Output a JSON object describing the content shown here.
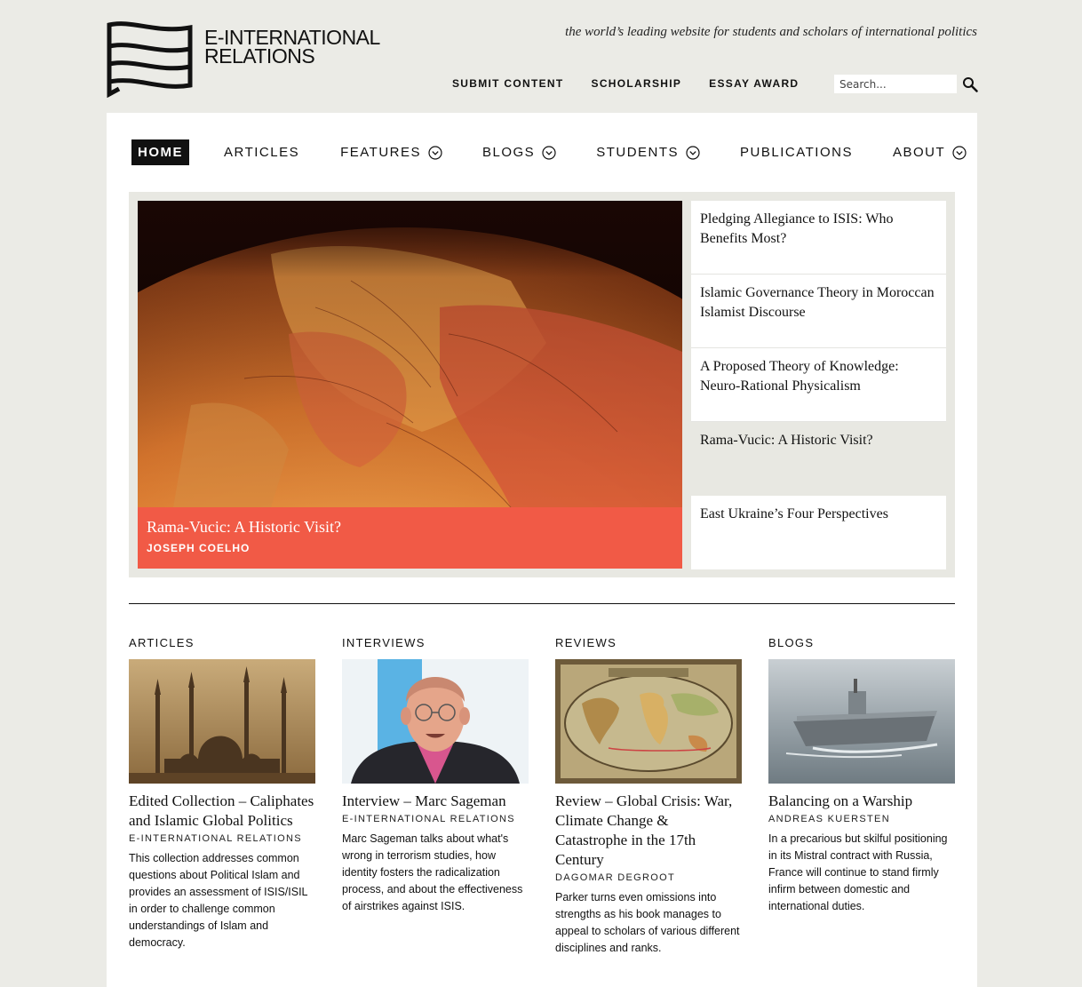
{
  "header": {
    "logo_line1": "E-INTERNATIONAL",
    "logo_line2": "RELATIONS",
    "tagline": "the world’s leading website for students and scholars of international politics",
    "top_links": [
      "SUBMIT CONTENT",
      "SCHOLARSHIP",
      "ESSAY AWARD"
    ],
    "search_placeholder": "Search..."
  },
  "main_nav": {
    "items": [
      {
        "label": "HOME",
        "active": true,
        "dropdown": false
      },
      {
        "label": "ARTICLES",
        "active": false,
        "dropdown": false
      },
      {
        "label": "FEATURES",
        "active": false,
        "dropdown": true
      },
      {
        "label": "BLOGS",
        "active": false,
        "dropdown": true
      },
      {
        "label": "STUDENTS",
        "active": false,
        "dropdown": true
      },
      {
        "label": "PUBLICATIONS",
        "active": false,
        "dropdown": false
      },
      {
        "label": "ABOUT",
        "active": false,
        "dropdown": true
      }
    ]
  },
  "featured": {
    "hero_title": "Rama-Vucic: A Historic Visit?",
    "hero_author": "JOSEPH COELHO",
    "hero_image": "globe-europe-map",
    "side_items": [
      "Pledging Allegiance to ISIS:  Who Benefits Most?",
      "Islamic Governance Theory in Moroccan Islamist Discourse",
      "A Proposed Theory of Knowledge: Neuro-Rational Physicalism",
      "Rama-Vucic: A Historic Visit?",
      "East Ukraine’s Four Perspectives"
    ],
    "accent_color": "#f15a46"
  },
  "sections": [
    {
      "heading": "ARTICLES",
      "image": "mosque-sepia",
      "title": "Edited Collection – Caliphates and Islamic Global Politics",
      "author": "E-INTERNATIONAL RELATIONS",
      "summary": "This collection addresses common questions about Political Islam and provides an assessment of ISIS/ISIL in order to challenge common understandings of Islam and democracy."
    },
    {
      "heading": "INTERVIEWS",
      "image": "portrait-man-glasses",
      "title": "Interview – Marc Sageman",
      "author": "E-INTERNATIONAL RELATIONS",
      "summary": "Marc Sageman talks about what's wrong in terrorism studies, how identity fosters the radicalization process, and about the effectiveness of airstrikes against ISIS."
    },
    {
      "heading": "REVIEWS",
      "image": "antique-world-map",
      "title": "Review – Global Crisis: War, Climate Change & Catastrophe in the 17th Century",
      "author": "DAGOMAR DEGROOT",
      "summary": "Parker turns even omissions into strengths as his book manages to appeal to scholars of various different disciplines and ranks."
    },
    {
      "heading": "BLOGS",
      "image": "warship-sea",
      "title": "Balancing on a Warship",
      "author": "ANDREAS KUERSTEN",
      "summary": "In a precarious but skilful positioning in its Mistral contract with Russia, France will continue to stand firmly infirm between domestic and international duties."
    }
  ]
}
